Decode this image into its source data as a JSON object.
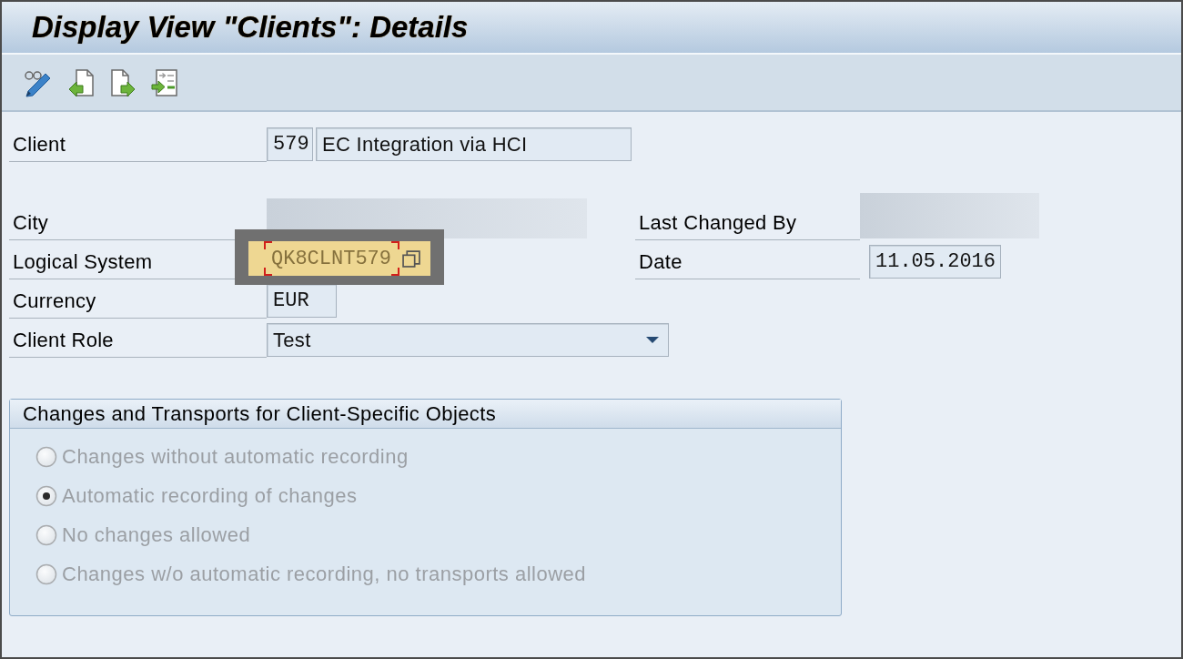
{
  "window": {
    "title": "Display View \"Clients\": Details"
  },
  "form": {
    "client": {
      "label": "Client",
      "number": "579",
      "description": "EC Integration via HCI"
    },
    "city": {
      "label": "City",
      "value_hidden": true
    },
    "last_changed_by": {
      "label": "Last Changed By",
      "value_hidden": true
    },
    "logical_system": {
      "label": "Logical System",
      "value": "QK8CLNT579",
      "focused": true
    },
    "date": {
      "label": "Date",
      "value": "11.05.2016"
    },
    "currency": {
      "label": "Currency",
      "value": "EUR"
    },
    "client_role": {
      "label": "Client Role",
      "value": "Test"
    }
  },
  "group": {
    "title": "Changes and Transports for Client-Specific Objects",
    "options": [
      {
        "label": "Changes without automatic recording",
        "selected": false,
        "disabled": true
      },
      {
        "label": "Automatic recording of changes",
        "selected": true,
        "disabled": true
      },
      {
        "label": "No changes allowed",
        "selected": false,
        "disabled": true
      },
      {
        "label": "Changes w/o automatic recording, no transports allowed",
        "selected": false,
        "disabled": true
      }
    ]
  }
}
